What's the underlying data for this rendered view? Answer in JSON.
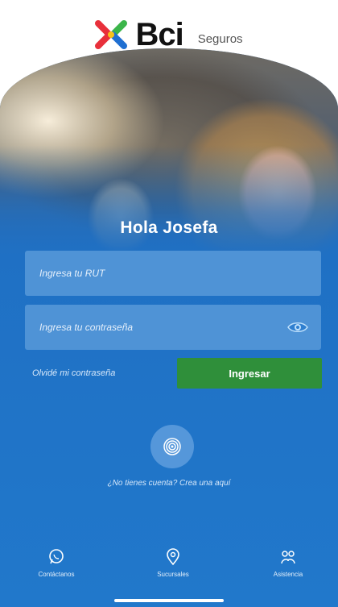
{
  "header": {
    "brand": "Bci",
    "brand_sub": "Seguros"
  },
  "greeting": "Hola Josefa",
  "login": {
    "rut_placeholder": "Ingresa tu RUT",
    "password_placeholder": "Ingresa tu contraseña",
    "forgot_label": "Olvidé mi contraseña",
    "submit_label": "Ingresar"
  },
  "signup_text": "¿No tienes cuenta? Crea una aquí",
  "bottom_nav": {
    "contact": "Contáctanos",
    "branches": "Sucursales",
    "assistance": "Asistencia"
  },
  "colors": {
    "primary_blue": "#1f70c4",
    "field_blue": "#4f93d6",
    "button_green": "#2f8f3a",
    "logo_blue": "#1f6fd1",
    "logo_red": "#e8303b",
    "logo_green": "#3bb54a",
    "logo_yellow": "#f7c21a"
  },
  "icons": {
    "logo": "bci-x-logo",
    "password_toggle": "eye-icon",
    "biometric": "fingerprint-icon",
    "contact": "whatsapp-icon",
    "branches": "map-pin-icon",
    "assistance": "assistance-icon"
  }
}
